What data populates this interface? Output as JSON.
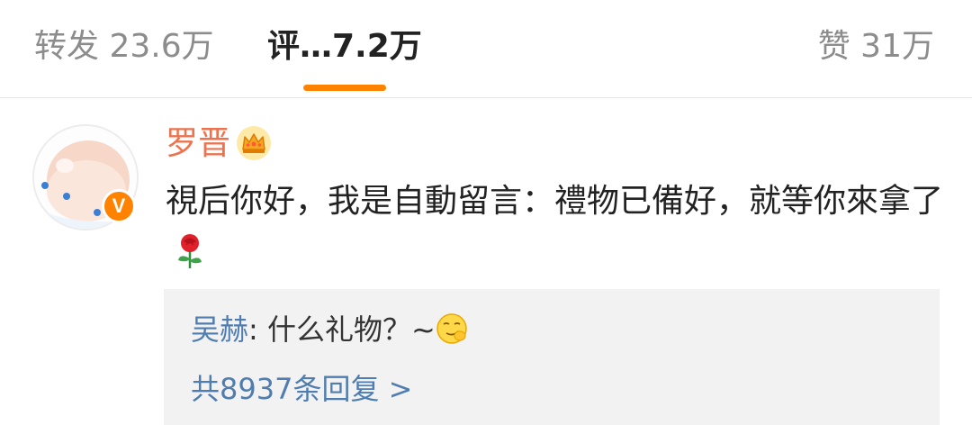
{
  "tabs": {
    "repost": "转发 23.6万",
    "comments": "评…7.2万",
    "likes": "赞 31万"
  },
  "accent_color": "#ff8200",
  "comment": {
    "username": "罗晋",
    "username_icon": "crown-icon",
    "verified_badge": "V",
    "text": "視后你好，我是自動留言：禮物已備好，就等你來拿了",
    "trailing_icon": "rose-icon",
    "reply": {
      "author": "吴赫",
      "separator": ": ",
      "text": "什么礼物？~",
      "trailing_icon": "smirk-icon"
    },
    "view_replies": "共8937条回复 >"
  }
}
